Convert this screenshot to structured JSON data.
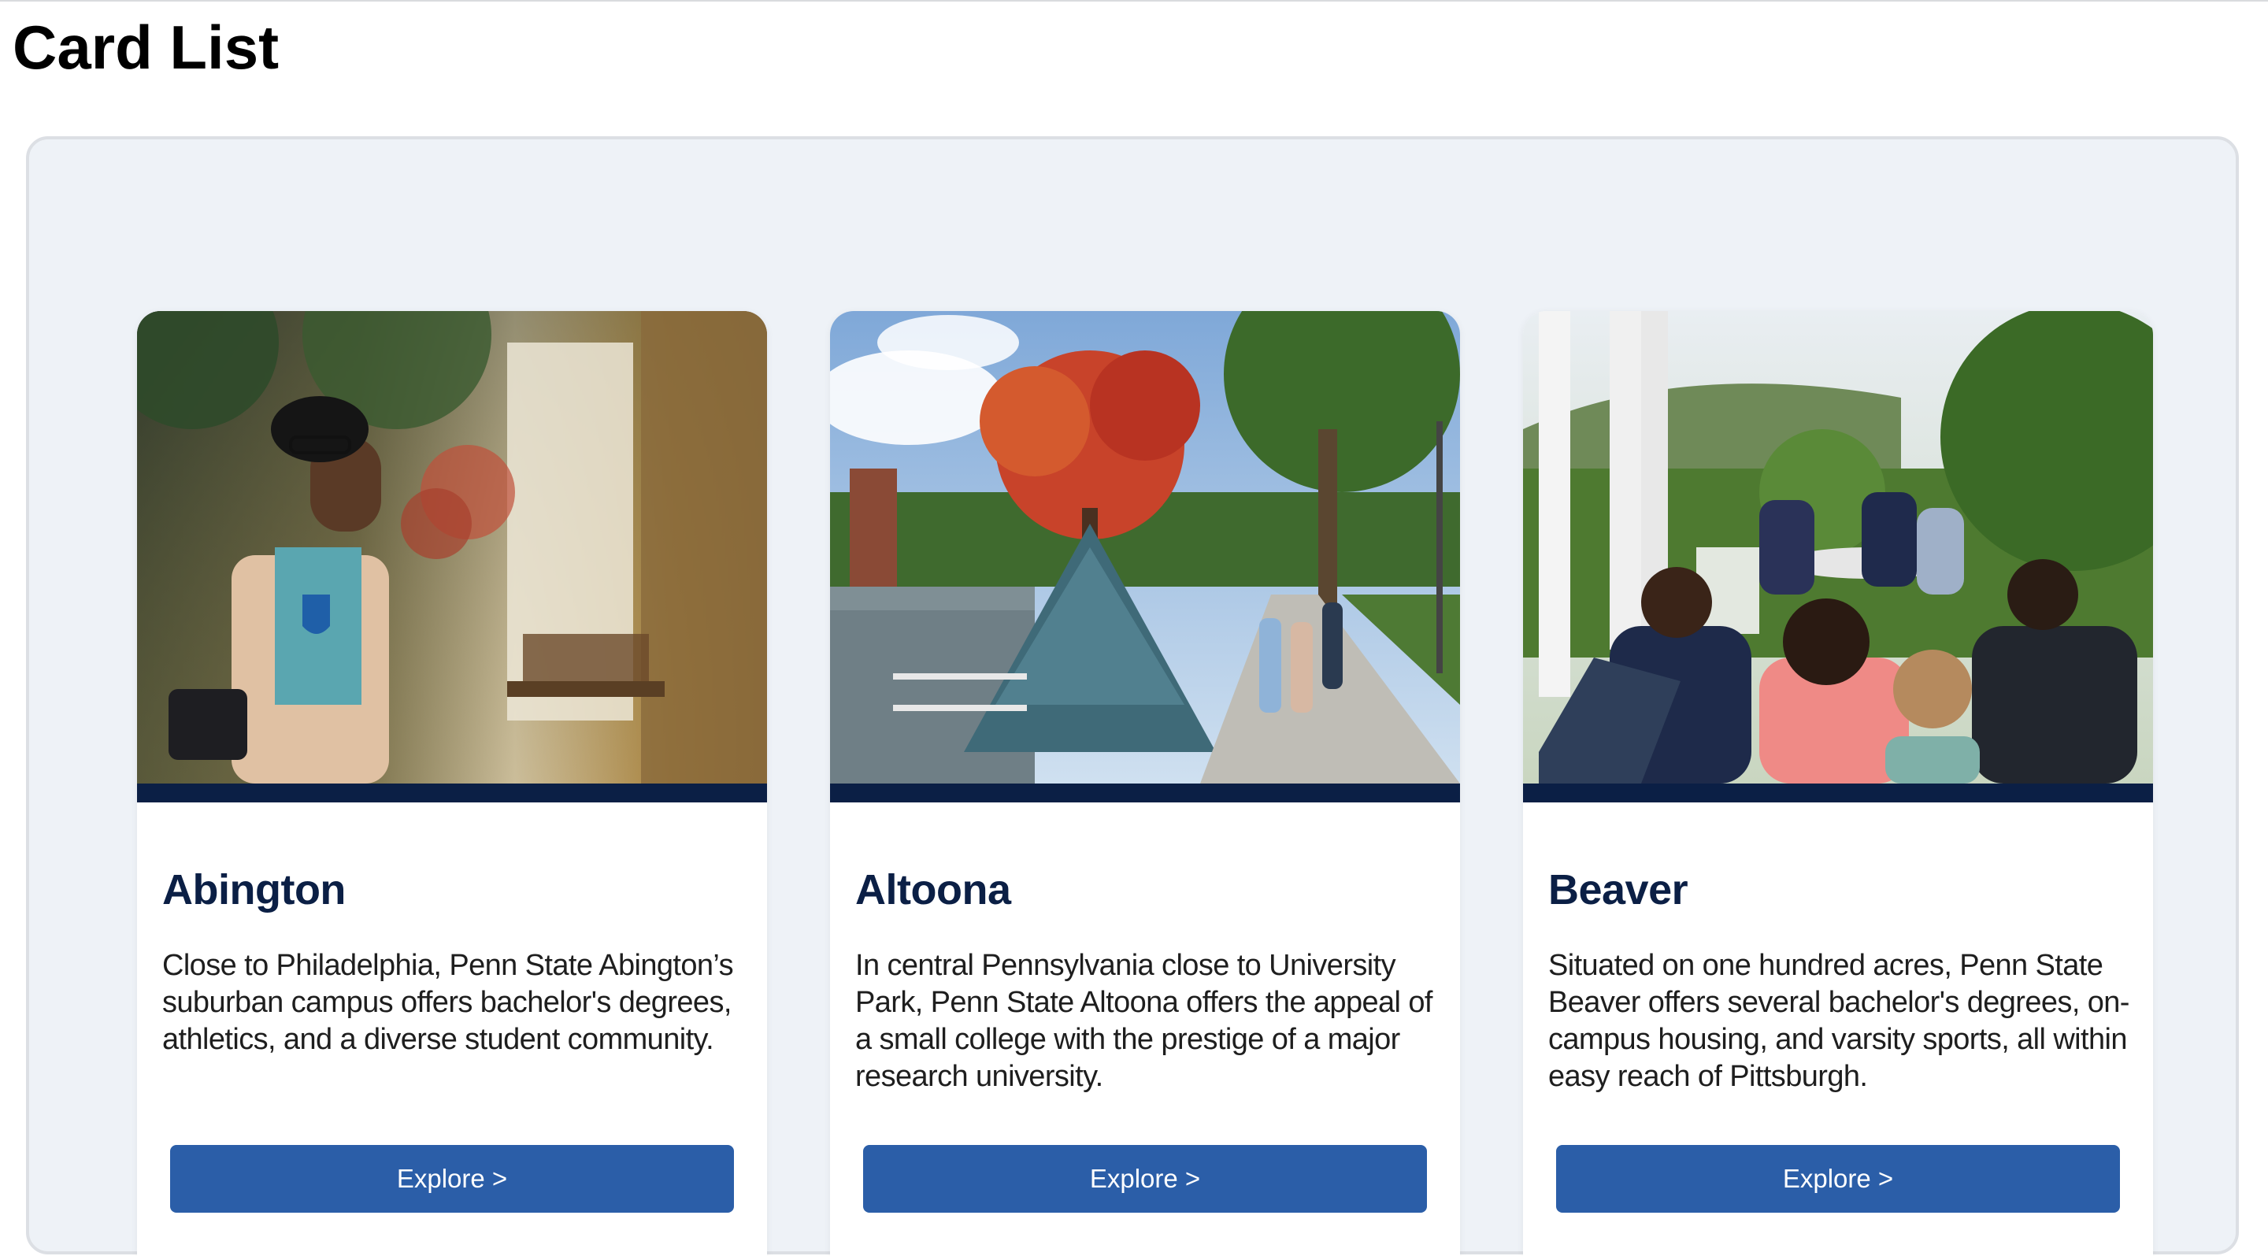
{
  "page": {
    "title": "Card List"
  },
  "colors": {
    "card_bar": "#0b1f45",
    "heading": "#0b1f45",
    "button": "#2b5ea8",
    "panel": "#eef2f7"
  },
  "cards": [
    {
      "title": "Abington",
      "description": "Close to Philadelphia, Penn State Abington’s suburban campus offers bachelor's degrees, athletics, and a diverse student community.",
      "button_label": "Explore >",
      "image": "student-portrait-photo"
    },
    {
      "title": "Altoona",
      "description": "In central Pennsylvania close to University Park, Penn State Altoona offers the appeal of a small college with the prestige of a major research university.",
      "button_label": "Explore >",
      "image": "autumn-campus-walkway-photo"
    },
    {
      "title": "Beaver",
      "description": "Situated on one hundred acres, Penn State Beaver offers several bachelor's degrees, on-campus housing, and varsity sports, all within easy reach of Pittsburgh.",
      "button_label": "Explore >",
      "image": "students-outdoor-study-photo"
    }
  ]
}
